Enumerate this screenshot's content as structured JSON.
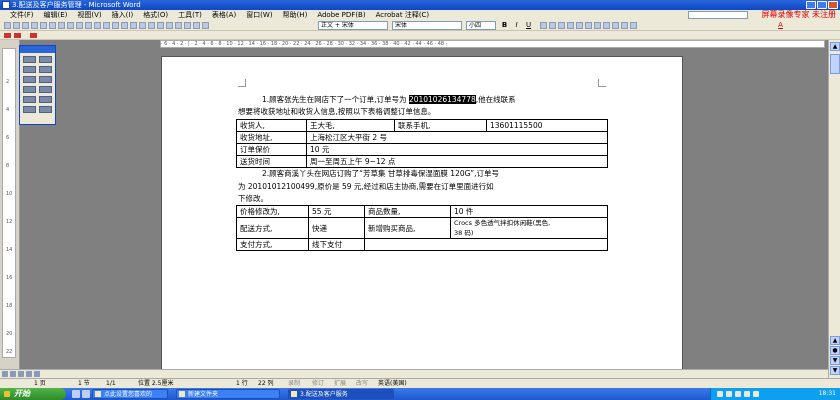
{
  "window": {
    "title": "3.配送及客户服务管理 - Microsoft Word",
    "recorder_label": "屏幕录像专家 未注册"
  },
  "menu": [
    "文件(F)",
    "编辑(E)",
    "视图(V)",
    "插入(I)",
    "格式(O)",
    "工具(T)",
    "表格(A)",
    "窗口(W)",
    "帮助(H)",
    "Adobe PDF(B)",
    "Acrobat 注释(C)"
  ],
  "toolbar": {
    "style_value": "正文 + 宋体",
    "font_value": "宋体",
    "size_value": "小四",
    "bold": "B",
    "italic": "I",
    "underline": "U",
    "font_color": "A"
  },
  "ruler": {
    "ticks": "· 6 · 4 · 2 · | · 2 · 4 · 6 · 8 · 10 · 12 · 14 · 16 · 18 · 20 · 22 · 24 · 26 · 28 · 30 · 32 · 34 · 36 · 38 · 40 · 42 · 44 · 46 · 48 ·"
  },
  "vruler": [
    "2",
    "4",
    "6",
    "8",
    "10",
    "12",
    "14",
    "16",
    "18",
    "20",
    "22"
  ],
  "document": {
    "q1_prefix": "1.顾客张先生在网店下了一个订单,订单号为",
    "q1_order_no": "20101026134778",
    "q1_suffix": ",他在线联系",
    "q1_line2": "想要将收获地址和收货人信息,按照以下表格调整订单信息。",
    "table1": [
      [
        "收货人,",
        "王大毛,",
        "联系手机,",
        "13601115500"
      ],
      [
        "收货地址,",
        "上海松江区大平街 2 号"
      ],
      [
        "订单保价",
        "10 元"
      ],
      [
        "送货时间",
        "周一至周五上午 9~12 点"
      ]
    ],
    "q2_line1": "2.顾客商溪丫头在网店订购了“芳草集 甘草排毒保湿面膜 120G”,订单号",
    "q2_line2": "为 20101012100499,原价是 59 元,经过和店主协商,需要在订单里面进行如",
    "q2_line3": "下修改。",
    "table2": [
      [
        "价格修改为,",
        "55 元",
        "商品数量,",
        "10 件"
      ],
      [
        "配送方式,",
        "快递",
        "新增购买商品,",
        "Crocs 多色透气拌扣休闲鞋(黑色,",
        "38 码)"
      ],
      [
        "支付方式,",
        "线下支付",
        ""
      ]
    ]
  },
  "status": {
    "page": "1 页",
    "section": "1 节",
    "pages": "1/1",
    "position": "位置 2.5厘米",
    "row": "1 行",
    "col": "22 列",
    "rec": "录制",
    "trk": "修订",
    "ext": "扩展",
    "ovr": "改写",
    "lang": "英语(美国)"
  },
  "taskbar": {
    "start": "开始",
    "tasks": [
      "点此设置您喜欢的",
      "新建文件夹",
      "3.配送及客户服务"
    ],
    "clock": "18:31"
  },
  "colors": {
    "title_blue": "#0b47c7",
    "taskbar_blue": "#245edb",
    "start_green": "#3c9f36",
    "highlight": "#000000"
  }
}
